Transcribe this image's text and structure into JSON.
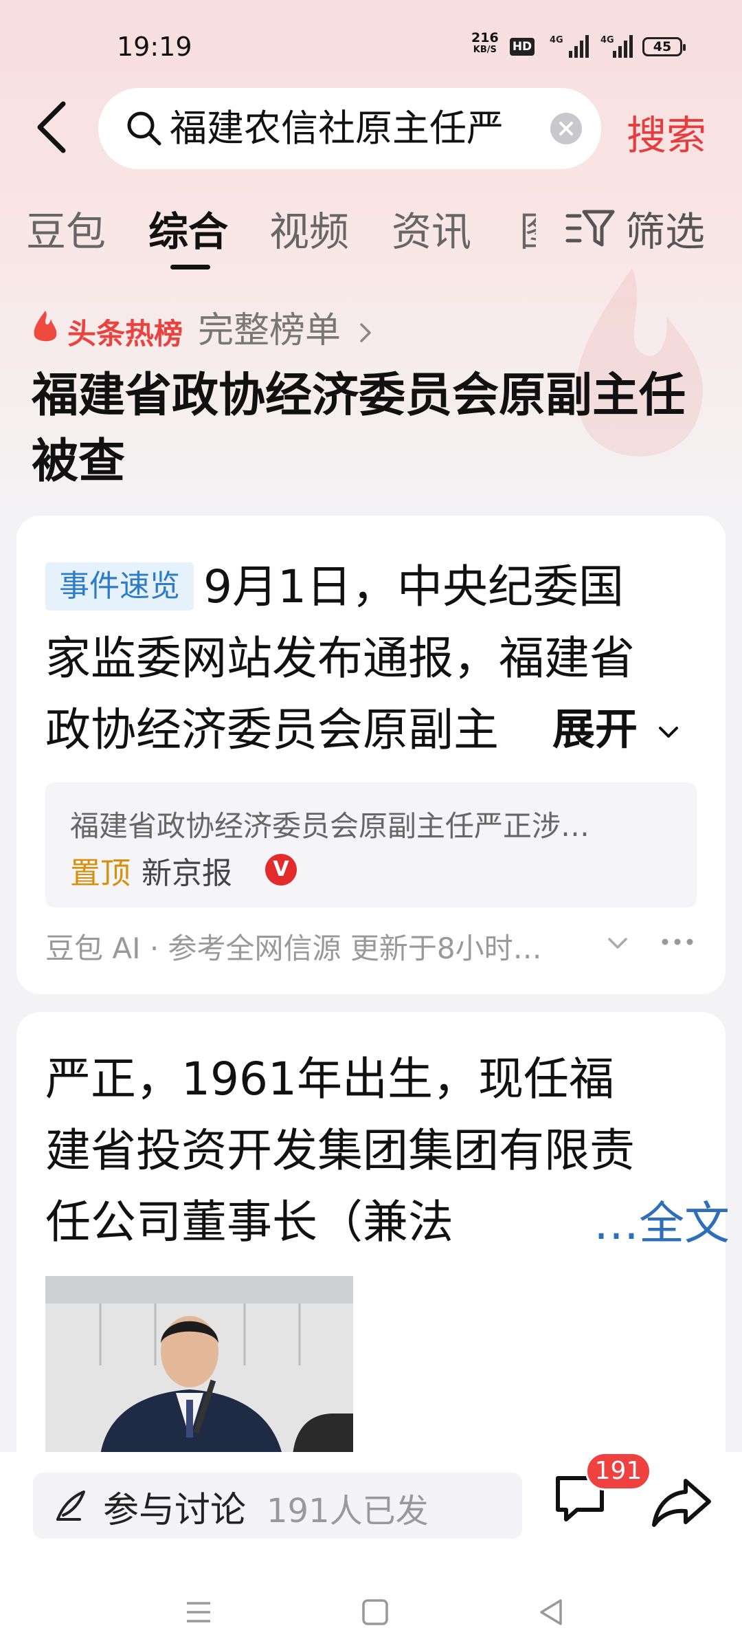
{
  "status_bar": {
    "time": "19:19",
    "net_speed_value": "216",
    "net_speed_unit": "KB/S",
    "hd_label": "HD",
    "signal_1_label": "4G",
    "signal_2_label": "4G",
    "battery": "45"
  },
  "search": {
    "query": "福建农信社原主任严",
    "submit_label": "搜索"
  },
  "tabs": [
    {
      "label": "豆包"
    },
    {
      "label": "综合"
    },
    {
      "label": "视频"
    },
    {
      "label": "资讯"
    }
  ],
  "tab_partial": "图",
  "filter_label": "筛选",
  "hot": {
    "tag": "头条热榜",
    "full_list": "完整榜单",
    "title": "福建省政协经济委员会原副主任被查"
  },
  "card1": {
    "badge": "事件速览",
    "line1": "9月1日，中央纪委国",
    "line2": "家监委网站发布通报，福建省",
    "line3": "政协经济委员会原副主",
    "expand": "展开",
    "source_snippet": "福建省政协经济委员会原副主任严正涉…",
    "pin_label": "置顶",
    "source_name": "新京报",
    "v_badge": "V",
    "ai_meta": "豆包 AI · 参考全网信源 更新于8小时…"
  },
  "card2": {
    "line1": "严正，1961年出生，现任福",
    "line2": "建省投资开发集团集团有限责",
    "line3": "任公司董事长（兼法",
    "full_text": "…全文"
  },
  "bottom": {
    "discuss_label": "参与讨论",
    "discuss_count": "191人已发",
    "comment_badge": "191"
  },
  "colors": {
    "accent_red": "#e53c3c",
    "link_blue": "#2d6fba",
    "badge_blue_bg": "#e5f1fb",
    "pin_orange": "#d6900d"
  },
  "icons": [
    "back-arrow-icon",
    "search-icon",
    "clear-icon",
    "filter-icon",
    "fire-icon",
    "chevron-right-icon",
    "chevron-down-icon",
    "more-icon",
    "pen-icon",
    "comment-icon",
    "share-icon",
    "menu-icon",
    "home-icon",
    "back-triangle-icon"
  ]
}
